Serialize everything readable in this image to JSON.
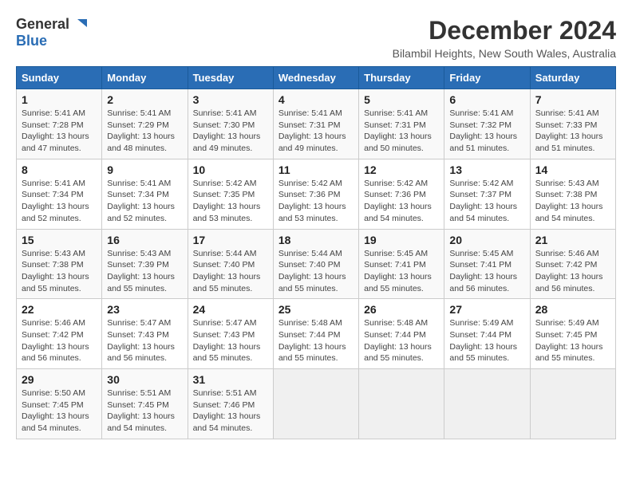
{
  "logo": {
    "line1": "General",
    "line2": "Blue"
  },
  "title": "December 2024",
  "location": "Bilambil Heights, New South Wales, Australia",
  "weekdays": [
    "Sunday",
    "Monday",
    "Tuesday",
    "Wednesday",
    "Thursday",
    "Friday",
    "Saturday"
  ],
  "weeks": [
    [
      {
        "day": "1",
        "info": "Sunrise: 5:41 AM\nSunset: 7:28 PM\nDaylight: 13 hours\nand 47 minutes."
      },
      {
        "day": "2",
        "info": "Sunrise: 5:41 AM\nSunset: 7:29 PM\nDaylight: 13 hours\nand 48 minutes."
      },
      {
        "day": "3",
        "info": "Sunrise: 5:41 AM\nSunset: 7:30 PM\nDaylight: 13 hours\nand 49 minutes."
      },
      {
        "day": "4",
        "info": "Sunrise: 5:41 AM\nSunset: 7:31 PM\nDaylight: 13 hours\nand 49 minutes."
      },
      {
        "day": "5",
        "info": "Sunrise: 5:41 AM\nSunset: 7:31 PM\nDaylight: 13 hours\nand 50 minutes."
      },
      {
        "day": "6",
        "info": "Sunrise: 5:41 AM\nSunset: 7:32 PM\nDaylight: 13 hours\nand 51 minutes."
      },
      {
        "day": "7",
        "info": "Sunrise: 5:41 AM\nSunset: 7:33 PM\nDaylight: 13 hours\nand 51 minutes."
      }
    ],
    [
      {
        "day": "8",
        "info": "Sunrise: 5:41 AM\nSunset: 7:34 PM\nDaylight: 13 hours\nand 52 minutes."
      },
      {
        "day": "9",
        "info": "Sunrise: 5:41 AM\nSunset: 7:34 PM\nDaylight: 13 hours\nand 52 minutes."
      },
      {
        "day": "10",
        "info": "Sunrise: 5:42 AM\nSunset: 7:35 PM\nDaylight: 13 hours\nand 53 minutes."
      },
      {
        "day": "11",
        "info": "Sunrise: 5:42 AM\nSunset: 7:36 PM\nDaylight: 13 hours\nand 53 minutes."
      },
      {
        "day": "12",
        "info": "Sunrise: 5:42 AM\nSunset: 7:36 PM\nDaylight: 13 hours\nand 54 minutes."
      },
      {
        "day": "13",
        "info": "Sunrise: 5:42 AM\nSunset: 7:37 PM\nDaylight: 13 hours\nand 54 minutes."
      },
      {
        "day": "14",
        "info": "Sunrise: 5:43 AM\nSunset: 7:38 PM\nDaylight: 13 hours\nand 54 minutes."
      }
    ],
    [
      {
        "day": "15",
        "info": "Sunrise: 5:43 AM\nSunset: 7:38 PM\nDaylight: 13 hours\nand 55 minutes."
      },
      {
        "day": "16",
        "info": "Sunrise: 5:43 AM\nSunset: 7:39 PM\nDaylight: 13 hours\nand 55 minutes."
      },
      {
        "day": "17",
        "info": "Sunrise: 5:44 AM\nSunset: 7:40 PM\nDaylight: 13 hours\nand 55 minutes."
      },
      {
        "day": "18",
        "info": "Sunrise: 5:44 AM\nSunset: 7:40 PM\nDaylight: 13 hours\nand 55 minutes."
      },
      {
        "day": "19",
        "info": "Sunrise: 5:45 AM\nSunset: 7:41 PM\nDaylight: 13 hours\nand 55 minutes."
      },
      {
        "day": "20",
        "info": "Sunrise: 5:45 AM\nSunset: 7:41 PM\nDaylight: 13 hours\nand 56 minutes."
      },
      {
        "day": "21",
        "info": "Sunrise: 5:46 AM\nSunset: 7:42 PM\nDaylight: 13 hours\nand 56 minutes."
      }
    ],
    [
      {
        "day": "22",
        "info": "Sunrise: 5:46 AM\nSunset: 7:42 PM\nDaylight: 13 hours\nand 56 minutes."
      },
      {
        "day": "23",
        "info": "Sunrise: 5:47 AM\nSunset: 7:43 PM\nDaylight: 13 hours\nand 56 minutes."
      },
      {
        "day": "24",
        "info": "Sunrise: 5:47 AM\nSunset: 7:43 PM\nDaylight: 13 hours\nand 55 minutes."
      },
      {
        "day": "25",
        "info": "Sunrise: 5:48 AM\nSunset: 7:44 PM\nDaylight: 13 hours\nand 55 minutes."
      },
      {
        "day": "26",
        "info": "Sunrise: 5:48 AM\nSunset: 7:44 PM\nDaylight: 13 hours\nand 55 minutes."
      },
      {
        "day": "27",
        "info": "Sunrise: 5:49 AM\nSunset: 7:44 PM\nDaylight: 13 hours\nand 55 minutes."
      },
      {
        "day": "28",
        "info": "Sunrise: 5:49 AM\nSunset: 7:45 PM\nDaylight: 13 hours\nand 55 minutes."
      }
    ],
    [
      {
        "day": "29",
        "info": "Sunrise: 5:50 AM\nSunset: 7:45 PM\nDaylight: 13 hours\nand 54 minutes."
      },
      {
        "day": "30",
        "info": "Sunrise: 5:51 AM\nSunset: 7:45 PM\nDaylight: 13 hours\nand 54 minutes."
      },
      {
        "day": "31",
        "info": "Sunrise: 5:51 AM\nSunset: 7:46 PM\nDaylight: 13 hours\nand 54 minutes."
      },
      {
        "day": "",
        "info": ""
      },
      {
        "day": "",
        "info": ""
      },
      {
        "day": "",
        "info": ""
      },
      {
        "day": "",
        "info": ""
      }
    ]
  ]
}
